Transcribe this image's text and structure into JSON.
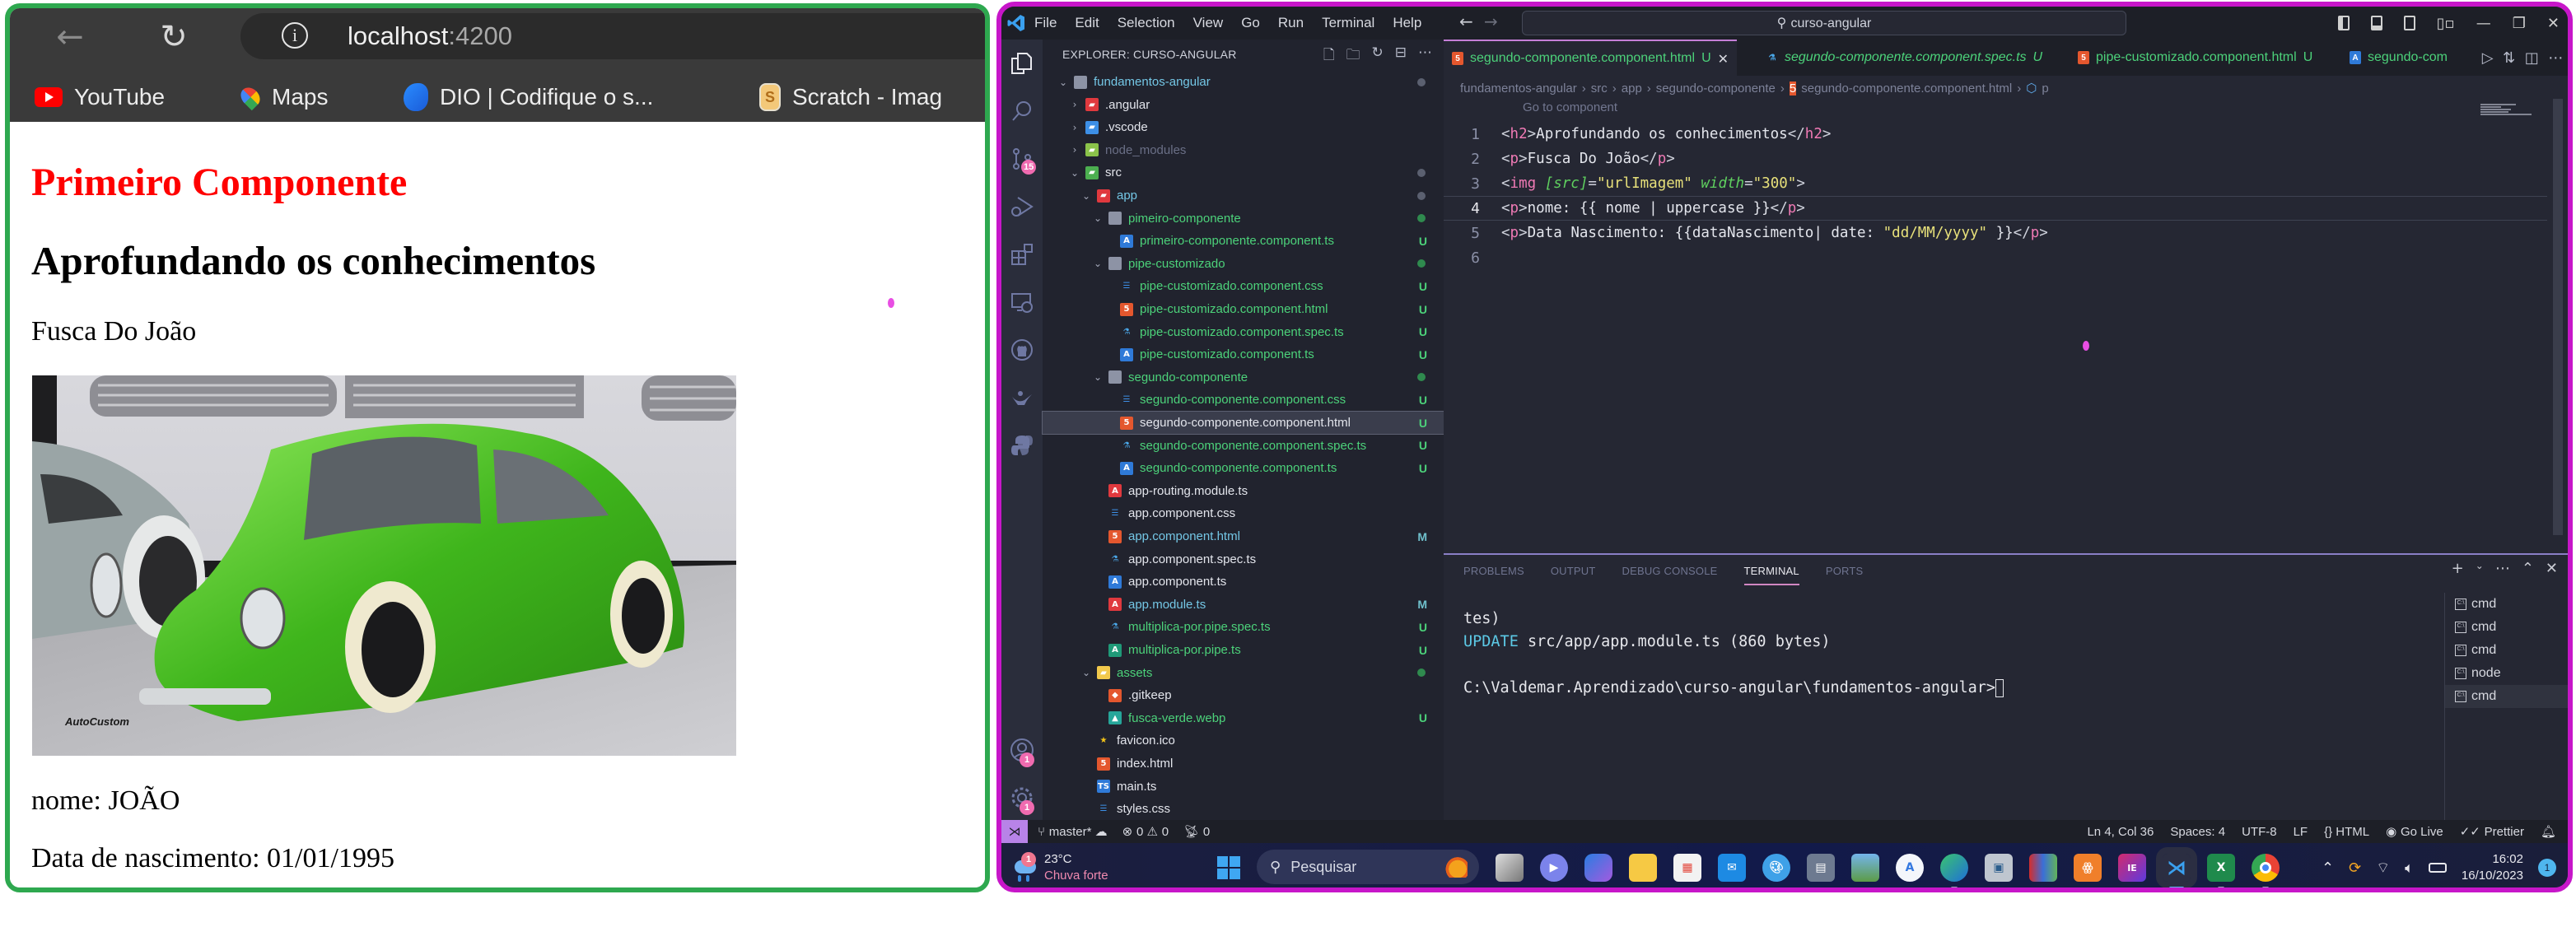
{
  "browser": {
    "url_host": "localhost",
    "url_port": ":4200",
    "bookmarks": [
      {
        "label": "YouTube",
        "icon": "youtube-icon"
      },
      {
        "label": "Maps",
        "icon": "maps-icon"
      },
      {
        "label": "DIO | Codifique o s...",
        "icon": "dio-icon"
      },
      {
        "label": "Scratch - Imag",
        "icon": "scratch-icon"
      }
    ],
    "page": {
      "heading1": "Primeiro Componente",
      "heading2": "Aprofundando os conhecimentos",
      "car_title": "Fusca Do João",
      "image_alt": "Green Volkswagen Beetle (fusca-verde.webp)",
      "image_watermark": "AutoCustom",
      "nome": "nome: JOÃO",
      "data_nascimento": "Data de nascimento: 01/01/1995"
    }
  },
  "vscode": {
    "menu": [
      "File",
      "Edit",
      "Selection",
      "View",
      "Go",
      "Run",
      "Terminal",
      "Help"
    ],
    "command_center": "curso-angular",
    "explorer_title": "EXPLORER: CURSO-ANGULAR",
    "tree": [
      {
        "label": "fundamentos-angular",
        "type": "folder",
        "open": true,
        "depth": 0,
        "color": "blue",
        "decor": "dot-gray"
      },
      {
        "label": ".angular",
        "type": "folder",
        "open": false,
        "depth": 1,
        "color": "white",
        "icon": "angular-folder"
      },
      {
        "label": ".vscode",
        "type": "folder",
        "open": false,
        "depth": 1,
        "color": "white",
        "icon": "vscode-folder"
      },
      {
        "label": "node_modules",
        "type": "folder",
        "open": false,
        "depth": 1,
        "color": "dim",
        "icon": "node-folder"
      },
      {
        "label": "src",
        "type": "folder",
        "open": true,
        "depth": 1,
        "color": "white",
        "icon": "src-folder",
        "decor": "dot-gray"
      },
      {
        "label": "app",
        "type": "folder",
        "open": true,
        "depth": 2,
        "color": "blue",
        "icon": "app-folder",
        "decor": "dot-gray"
      },
      {
        "label": "pimeiro-componente",
        "type": "folder",
        "open": true,
        "depth": 3,
        "color": "green",
        "decor": "dot-green"
      },
      {
        "label": "primeiro-componente.component.ts",
        "type": "file",
        "depth": 4,
        "color": "green",
        "icon": "angular-ts",
        "status": "U"
      },
      {
        "label": "pipe-customizado",
        "type": "folder",
        "open": true,
        "depth": 3,
        "color": "green",
        "decor": "dot-green"
      },
      {
        "label": "pipe-customizado.component.css",
        "type": "file",
        "depth": 4,
        "color": "green",
        "icon": "css",
        "status": "U"
      },
      {
        "label": "pipe-customizado.component.html",
        "type": "file",
        "depth": 4,
        "color": "green",
        "icon": "html",
        "status": "U"
      },
      {
        "label": "pipe-customizado.component.spec.ts",
        "type": "file",
        "depth": 4,
        "color": "green",
        "icon": "spec",
        "status": "U"
      },
      {
        "label": "pipe-customizado.component.ts",
        "type": "file",
        "depth": 4,
        "color": "green",
        "icon": "angular-ts",
        "status": "U"
      },
      {
        "label": "segundo-componente",
        "type": "folder",
        "open": true,
        "depth": 3,
        "color": "green",
        "decor": "dot-green"
      },
      {
        "label": "segundo-componente.component.css",
        "type": "file",
        "depth": 4,
        "color": "green",
        "icon": "css",
        "status": "U"
      },
      {
        "label": "segundo-componente.component.html",
        "type": "file",
        "depth": 4,
        "color": "white",
        "icon": "html",
        "status": "U",
        "selected": true
      },
      {
        "label": "segundo-componente.component.spec.ts",
        "type": "file",
        "depth": 4,
        "color": "green",
        "icon": "spec",
        "status": "U"
      },
      {
        "label": "segundo-componente.component.ts",
        "type": "file",
        "depth": 4,
        "color": "green",
        "icon": "angular-ts",
        "status": "U"
      },
      {
        "label": "app-routing.module.ts",
        "type": "file",
        "depth": 3,
        "color": "white",
        "icon": "angular-module"
      },
      {
        "label": "app.component.css",
        "type": "file",
        "depth": 3,
        "color": "white",
        "icon": "css"
      },
      {
        "label": "app.component.html",
        "type": "file",
        "depth": 3,
        "color": "blue",
        "icon": "html",
        "status": "M"
      },
      {
        "label": "app.component.spec.ts",
        "type": "file",
        "depth": 3,
        "color": "white",
        "icon": "spec"
      },
      {
        "label": "app.component.ts",
        "type": "file",
        "depth": 3,
        "color": "white",
        "icon": "angular-ts"
      },
      {
        "label": "app.module.ts",
        "type": "file",
        "depth": 3,
        "color": "blue",
        "icon": "angular-module",
        "status": "M"
      },
      {
        "label": "multiplica-por.pipe.spec.ts",
        "type": "file",
        "depth": 3,
        "color": "green",
        "icon": "spec",
        "status": "U"
      },
      {
        "label": "multiplica-por.pipe.ts",
        "type": "file",
        "depth": 3,
        "color": "green",
        "icon": "angular-pipe",
        "status": "U"
      },
      {
        "label": "assets",
        "type": "folder",
        "open": true,
        "depth": 2,
        "color": "green",
        "icon": "assets-folder",
        "decor": "dot-green"
      },
      {
        "label": ".gitkeep",
        "type": "file",
        "depth": 3,
        "color": "white",
        "icon": "git"
      },
      {
        "label": "fusca-verde.webp",
        "type": "file",
        "depth": 3,
        "color": "green",
        "icon": "image",
        "status": "U"
      },
      {
        "label": "favicon.ico",
        "type": "file",
        "depth": 2,
        "color": "white",
        "icon": "star"
      },
      {
        "label": "index.html",
        "type": "file",
        "depth": 2,
        "color": "white",
        "icon": "html"
      },
      {
        "label": "main.ts",
        "type": "file",
        "depth": 2,
        "color": "white",
        "icon": "ts"
      },
      {
        "label": "styles.css",
        "type": "file",
        "depth": 2,
        "color": "white",
        "icon": "css"
      }
    ],
    "tabs": [
      {
        "label": "segundo-componente.component.html",
        "status": "U",
        "icon": "html",
        "active": true,
        "closable": true
      },
      {
        "label": "segundo-componente.component.spec.ts",
        "status": "U",
        "icon": "spec",
        "italic": true
      },
      {
        "label": "pipe-customizado.component.html",
        "status": "U",
        "icon": "html"
      },
      {
        "label": "segundo-com",
        "icon": "angular-ts"
      }
    ],
    "breadcrumb": [
      "fundamentos-angular",
      "src",
      "app",
      "segundo-componente",
      "segundo-componente.component.html",
      "p"
    ],
    "codelens": "Go to component",
    "code_lines": [
      {
        "n": "1",
        "tokens": [
          [
            "punc",
            "<"
          ],
          [
            "tag",
            "h2"
          ],
          [
            "punc",
            ">"
          ],
          [
            "text",
            "Aprofundando os conhecimentos"
          ],
          [
            "punc",
            "</"
          ],
          [
            "tag",
            "h2"
          ],
          [
            "punc",
            ">"
          ]
        ]
      },
      {
        "n": "2",
        "tokens": [
          [
            "punc",
            "<"
          ],
          [
            "tag",
            "p"
          ],
          [
            "punc",
            ">"
          ],
          [
            "text",
            "Fusca Do João"
          ],
          [
            "punc",
            "</"
          ],
          [
            "tag",
            "p"
          ],
          [
            "punc",
            ">"
          ]
        ]
      },
      {
        "n": "3",
        "tokens": [
          [
            "punc",
            "<"
          ],
          [
            "tag",
            "img"
          ],
          [
            "text",
            " "
          ],
          [
            "attr",
            "[src]"
          ],
          [
            "punc",
            "="
          ],
          [
            "str",
            "\"urlImagem\""
          ],
          [
            "text",
            " "
          ],
          [
            "attr",
            "width"
          ],
          [
            "punc",
            "="
          ],
          [
            "str",
            "\"300\""
          ],
          [
            "punc",
            ">"
          ]
        ]
      },
      {
        "n": "4",
        "tokens": [
          [
            "punc",
            "<"
          ],
          [
            "tag",
            "p"
          ],
          [
            "punc",
            ">"
          ],
          [
            "text",
            "nome: {{ nome | uppercase }}"
          ],
          [
            "punc",
            "</"
          ],
          [
            "tag",
            "p"
          ],
          [
            "punc",
            ">"
          ]
        ],
        "current": true
      },
      {
        "n": "5",
        "tokens": [
          [
            "punc",
            "<"
          ],
          [
            "tag",
            "p"
          ],
          [
            "punc",
            ">"
          ],
          [
            "text",
            "Data Nascimento: {{dataNascimento| date: "
          ],
          [
            "str",
            "\"dd/MM/yyyy\""
          ],
          [
            "text",
            " }}"
          ],
          [
            "punc",
            "</"
          ],
          [
            "tag",
            "p"
          ],
          [
            "punc",
            ">"
          ]
        ]
      },
      {
        "n": "6",
        "tokens": []
      }
    ],
    "panel": {
      "tabs": [
        "PROBLEMS",
        "OUTPUT",
        "DEBUG CONSOLE",
        "TERMINAL",
        "PORTS"
      ],
      "active_tab": "TERMINAL",
      "terminal_lines": [
        {
          "kw": "",
          "text": "tes)"
        },
        {
          "kw": "UPDATE",
          "text": " src/app/app.module.ts (860 bytes)"
        },
        {
          "kw": "",
          "text": ""
        },
        {
          "kw": "",
          "text": "C:\\Valdemar.Aprendizado\\curso-angular\\fundamentos-angular>",
          "cursor": true
        }
      ],
      "terminals": [
        {
          "label": "cmd"
        },
        {
          "label": "cmd"
        },
        {
          "label": "cmd"
        },
        {
          "label": "node"
        },
        {
          "label": "cmd",
          "active": true
        }
      ]
    },
    "activity_badges": {
      "source_control": "15",
      "accounts": "1",
      "settings": "1"
    },
    "status_bar": {
      "branch": "master*",
      "errors": "0",
      "warnings": "0",
      "ports": "0",
      "cursor_pos": "Ln 4, Col 36",
      "indent": "Spaces: 4",
      "encoding": "UTF-8",
      "eol": "LF",
      "language": "HTML",
      "go_live": "Go Live",
      "prettier": "Prettier"
    }
  },
  "taskbar": {
    "weather_temp": "23°C",
    "weather_cond": "Chuva forte",
    "weather_badge": "1",
    "search_placeholder": "Pesquisar",
    "apps": [
      "task-view",
      "teams",
      "copilot",
      "file-explorer",
      "store",
      "mail",
      "paint",
      "calculator",
      "photos",
      "android-studio",
      "edge",
      "remote-desktop",
      "library",
      "xampp",
      "intellij",
      "vscode",
      "excel",
      "chrome"
    ],
    "focused_app": "vscode",
    "time": "16:02",
    "date": "16/10/2023",
    "notifications": "1"
  },
  "colors": {
    "browser_frame": "#2ea84f",
    "vscode_frame": "#c716c9",
    "heading_red": "#ff0000",
    "git_untracked": "#4cd27a",
    "git_modified": "#6fc0cc"
  }
}
